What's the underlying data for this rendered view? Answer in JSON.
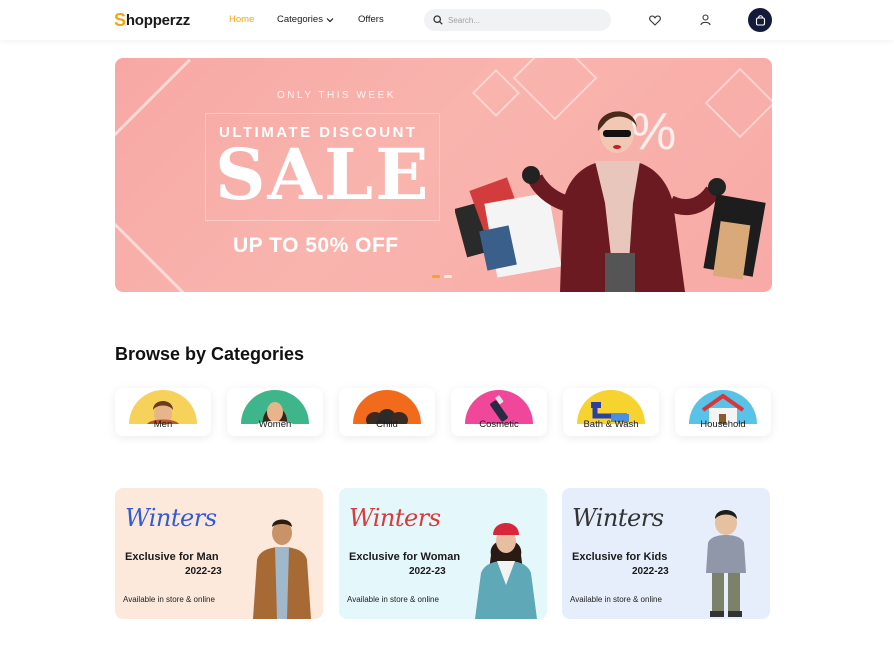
{
  "header": {
    "logo_initial": "S",
    "logo_rest": "hopperzz",
    "nav": {
      "home": "Home",
      "categories": "Categories",
      "offers": "Offers"
    },
    "search_placeholder": "Search...",
    "icons": [
      "search-icon",
      "heart-icon",
      "user-icon",
      "shopping-bag-icon"
    ]
  },
  "banner": {
    "kicker": "ONLY THIS WEEK",
    "headline": "ULTIMATE DISCOUNT",
    "big": "SALE",
    "offer": "UP TO 50% OFF",
    "percent_symbol": "%",
    "slides_total": 2,
    "slide_active": 1
  },
  "categories": {
    "title": "Browse by Categories",
    "items": [
      {
        "label": "Men",
        "color": "#f7d25b"
      },
      {
        "label": "Women",
        "color": "#3fb58c"
      },
      {
        "label": "Child",
        "color": "#f26b1d"
      },
      {
        "label": "Cosmetic",
        "color": "#f0479a"
      },
      {
        "label": "Bath & Wash",
        "color": "#f6d32e"
      },
      {
        "label": "Household",
        "color": "#58c3e6"
      }
    ]
  },
  "promos": [
    {
      "title": "Winters",
      "subtitle": "Exclusive for Man",
      "year": "2022-23",
      "note": "Available in store & online",
      "bg": "#fde9dc",
      "title_color": "#2f5bd4"
    },
    {
      "title": "Winters",
      "subtitle": "Exclusive for Woman",
      "year": "2022-23",
      "note": "Available in store & online",
      "bg": "#e4f7fb",
      "title_color": "#d93a3a"
    },
    {
      "title": "Winters",
      "subtitle": "Exclusive for Kids",
      "year": "2022-23",
      "note": "Available in store & online",
      "bg": "#e6eefb",
      "title_color": "#333333"
    }
  ],
  "colors": {
    "accent": "#f2a516",
    "dark": "#141b3a",
    "banner": "#f8aca7"
  }
}
